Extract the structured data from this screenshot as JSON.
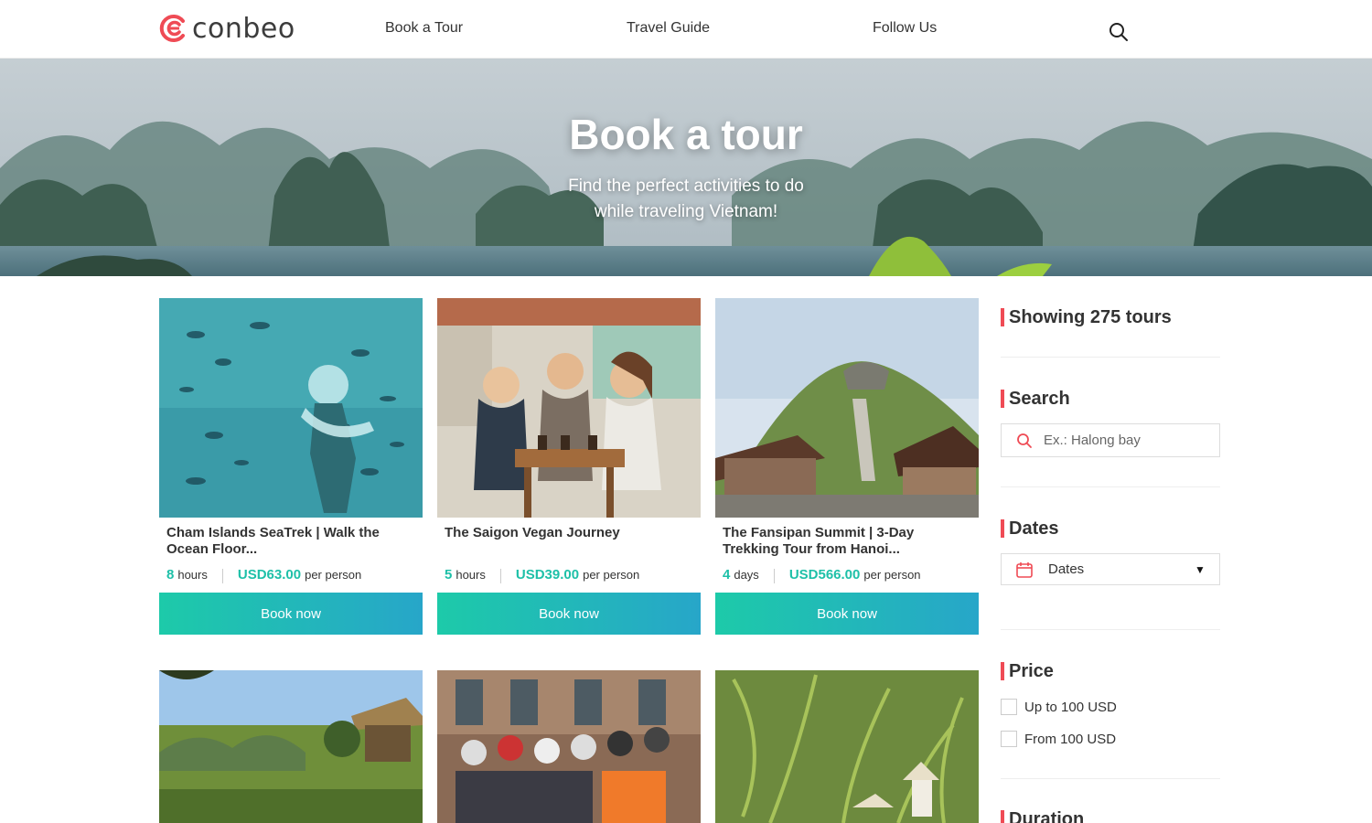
{
  "brand": {
    "name": "conbeo",
    "accent": "#ef4b55",
    "teal": "#1ec0a8"
  },
  "nav": {
    "links": [
      "Book a Tour",
      "Travel Guide",
      "Follow Us"
    ],
    "search_icon": "search-icon"
  },
  "hero": {
    "title": "Book a tour",
    "subtitle": "Find the perfect activities to do while traveling Vietnam!"
  },
  "tours": [
    {
      "title": "Cham Islands SeaTrek | Walk the Ocean Floor...",
      "duration_value": "8",
      "duration_unit": "hours",
      "price": "USD63.00",
      "price_unit": "per person",
      "button": "Book now"
    },
    {
      "title": "The Saigon Vegan Journey",
      "duration_value": "5",
      "duration_unit": "hours",
      "price": "USD39.00",
      "price_unit": "per person",
      "button": "Book now"
    },
    {
      "title": "The Fansipan Summit | 3-Day Trekking Tour from Hanoi...",
      "duration_value": "4",
      "duration_unit": "days",
      "price": "USD566.00",
      "price_unit": "per person",
      "button": "Book now"
    }
  ],
  "sidebar": {
    "showing": "Showing 275 tours",
    "search": {
      "heading": "Search",
      "placeholder": "Ex.: Halong bay"
    },
    "dates": {
      "heading": "Dates",
      "value": "Dates"
    },
    "price": {
      "heading": "Price",
      "options": [
        "Up to 100 USD",
        "From 100 USD"
      ]
    },
    "duration": {
      "heading": "Duration"
    }
  }
}
